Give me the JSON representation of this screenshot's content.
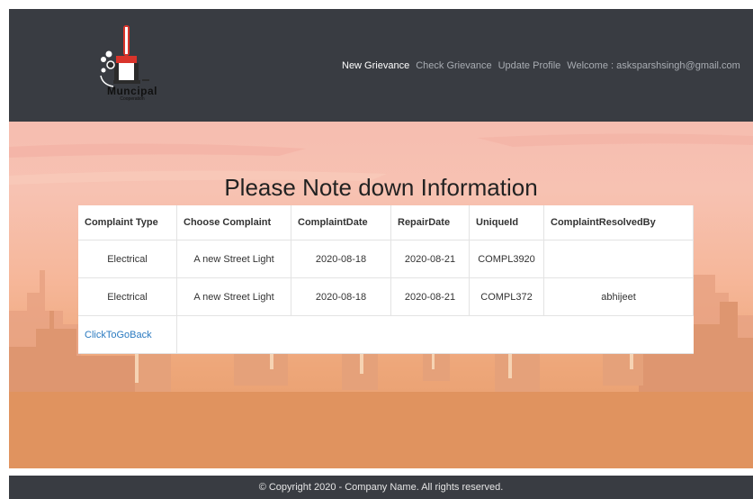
{
  "header": {
    "logo_name": "Muncipal",
    "logo_sub": "Cooperation",
    "nav": {
      "new_grievance": "New Grievance",
      "check_grievance": "Check Grievance",
      "update_profile": "Update Profile",
      "welcome": "Welcome : asksparshsingh@gmail.com"
    }
  },
  "main": {
    "title": "Please Note down Information",
    "table": {
      "headers": [
        "Complaint Type",
        "Choose Complaint",
        "ComplaintDate",
        "RepairDate",
        "UniqueId",
        "ComplaintResolvedBy"
      ],
      "rows": [
        [
          "Electrical",
          "A new Street Light",
          "2020-08-18",
          "2020-08-21",
          "COMPL3920",
          ""
        ],
        [
          "Electrical",
          "A new Street Light",
          "2020-08-18",
          "2020-08-21",
          "COMPL372",
          "abhijeet"
        ]
      ],
      "back_link": "ClickToGoBack"
    }
  },
  "footer": {
    "copyright": "© Copyright 2020 - Company Name. All rights reserved."
  },
  "colors": {
    "header_bg": "#393c42",
    "link": "#2a7ac0",
    "logo_red": "#d9342b"
  }
}
